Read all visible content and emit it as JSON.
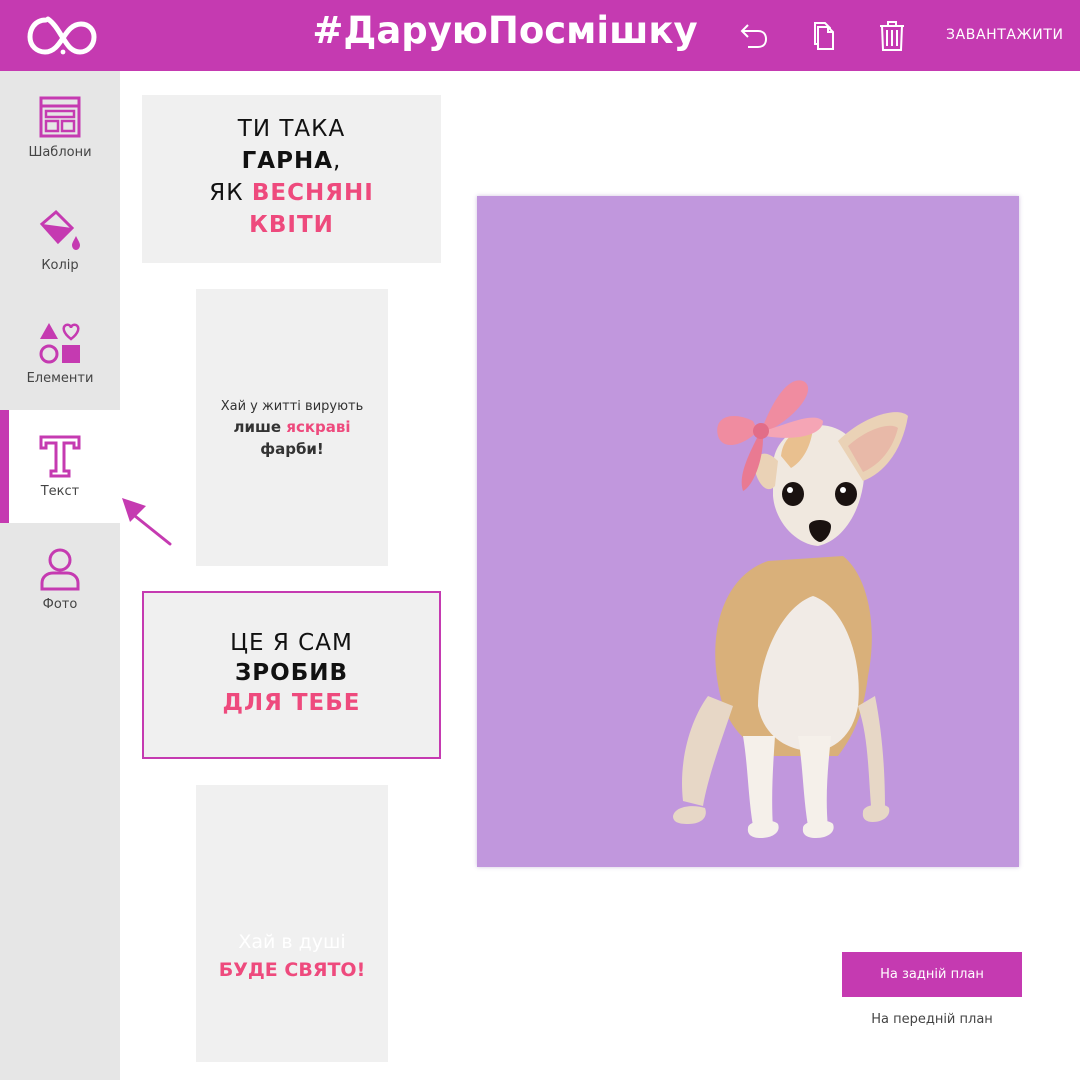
{
  "header": {
    "title": "#ДаруюПосмішку",
    "download_label": "ЗАВАНТАЖИТИ",
    "logo_icon": "infinity-logo-icon",
    "icons": [
      "undo-icon",
      "copy-icon",
      "trash-icon"
    ],
    "brand_color": "#c53ab1"
  },
  "sidebar": {
    "items": [
      {
        "label": "Шаблони",
        "icon": "templates-icon",
        "active": false
      },
      {
        "label": "Колір",
        "icon": "paint-bucket-icon",
        "active": false
      },
      {
        "label": "Елементи",
        "icon": "shapes-icon",
        "active": false
      },
      {
        "label": "Текст",
        "icon": "text-icon",
        "active": true
      },
      {
        "label": "Фото",
        "icon": "person-icon",
        "active": false
      }
    ]
  },
  "templates": [
    {
      "line1": "ТИ ТАКА",
      "line2": "ГАРНА",
      "line2_suffix": ",",
      "line3_prefix": "ЯК ",
      "line3_pink": "ВЕСНЯНІ",
      "line4_pink": "КВІТИ"
    },
    {
      "line1": "Хай у житті вирують",
      "line2_bold": "лише ",
      "line2_pink": "яскраві",
      "line3_bold": "фарби!"
    },
    {
      "line1": "ЦЕ Я САМ",
      "line2": "ЗРОБИВ",
      "line3_pink": "ДЛЯ ТЕБЕ",
      "selected": true
    },
    {
      "line1": "Хай в душі",
      "line2_pink": "БУДЕ СВЯТО!"
    }
  ],
  "canvas": {
    "background": "#c197dd"
  },
  "actions": {
    "send_back": "На задній план",
    "bring_front": "На передній план"
  },
  "accent_pink": "#ee4a7d"
}
